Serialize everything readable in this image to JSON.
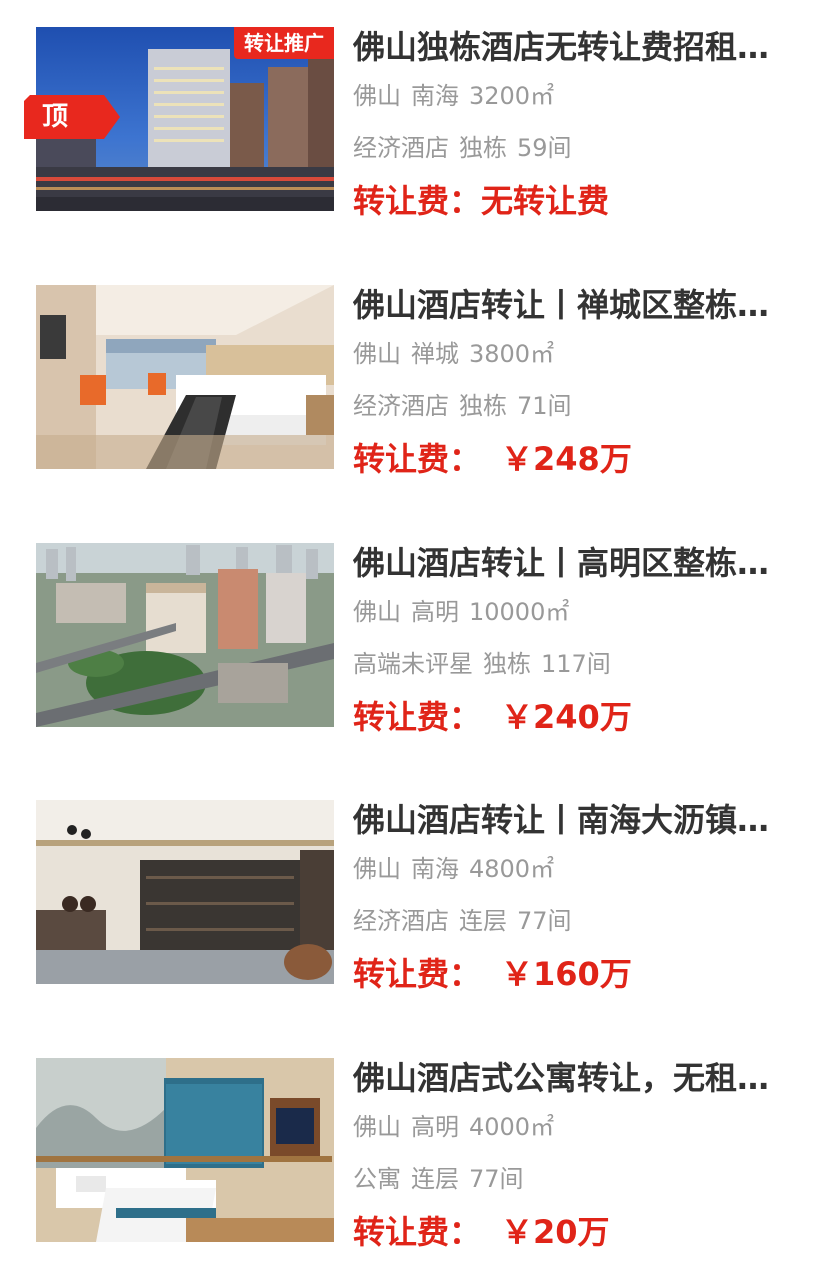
{
  "listings": [
    {
      "title": "佛山独栋酒店无转让费招租…",
      "city": "佛山",
      "district": "南海",
      "area": "3200㎡",
      "type": "经济酒店",
      "structure": "独栋",
      "rooms": "59间",
      "fee_label": "转让费：",
      "fee_value": "无转让费",
      "image": "hotel-exterior-night",
      "promo_tag": "转让推广",
      "top_badge": "顶"
    },
    {
      "title": "佛山酒店转让丨禅城区整栋…",
      "city": "佛山",
      "district": "禅城",
      "area": "3800㎡",
      "type": "经济酒店",
      "structure": "独栋",
      "rooms": "71间",
      "fee_label": "转让费：",
      "fee_value": "￥248万",
      "image": "hotel-room-bed"
    },
    {
      "title": "佛山酒店转让丨高明区整栋…",
      "city": "佛山",
      "district": "高明",
      "area": "10000㎡",
      "type": "高端未评星",
      "structure": "独栋",
      "rooms": "117间",
      "fee_label": "转让费：",
      "fee_value": "￥240万",
      "image": "aerial-city-view"
    },
    {
      "title": "佛山酒店转让丨南海大沥镇…",
      "city": "佛山",
      "district": "南海",
      "area": "4800㎡",
      "type": "经济酒店",
      "structure": "连层",
      "rooms": "77间",
      "fee_label": "转让费：",
      "fee_value": "￥160万",
      "image": "hotel-lobby-bookshelf"
    },
    {
      "title": "佛山酒店式公寓转让，无租…",
      "city": "佛山",
      "district": "高明",
      "area": "4000㎡",
      "type": "公寓",
      "structure": "连层",
      "rooms": "77间",
      "fee_label": "转让费：",
      "fee_value": "￥20万",
      "image": "apartment-twin-room"
    }
  ],
  "colors": {
    "title": "#333333",
    "meta": "#999999",
    "fee": "#e02418",
    "tag_bg": "#e8281e"
  }
}
